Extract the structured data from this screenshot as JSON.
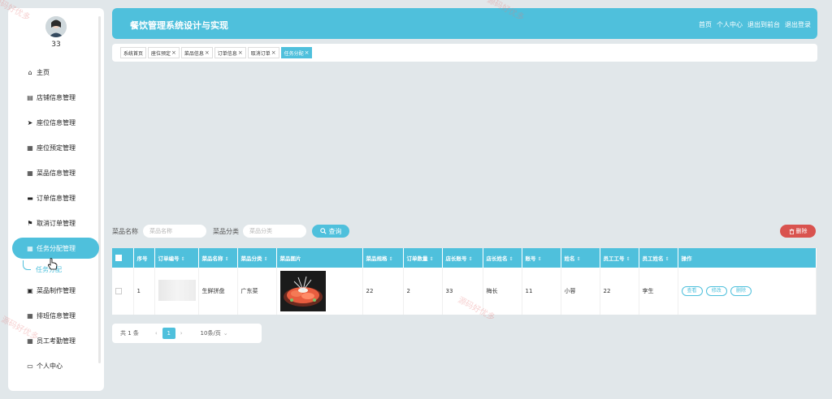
{
  "user": {
    "name": "33"
  },
  "menu": [
    {
      "label": "主页",
      "icon": "home-icon",
      "glyph": "⌂"
    },
    {
      "label": "店铺信息管理",
      "icon": "chart-icon",
      "glyph": "▤"
    },
    {
      "label": "座位信息管理",
      "icon": "send-icon",
      "glyph": "➤"
    },
    {
      "label": "座位预定管理",
      "icon": "grid-icon",
      "glyph": "▦"
    },
    {
      "label": "菜品信息管理",
      "icon": "apps-icon",
      "glyph": "▦"
    },
    {
      "label": "订单信息管理",
      "icon": "monitor-icon",
      "glyph": "▬"
    },
    {
      "label": "取消订单管理",
      "icon": "flag-icon",
      "glyph": "⚑"
    },
    {
      "label": "任务分配管理",
      "icon": "grid-icon",
      "glyph": "▦"
    },
    {
      "label": "菜品制作管理",
      "icon": "thumb-icon",
      "glyph": "▣"
    },
    {
      "label": "排班信息管理",
      "icon": "grid-icon",
      "glyph": "▦"
    },
    {
      "label": "员工考勤管理",
      "icon": "grid-icon",
      "glyph": "▦"
    },
    {
      "label": "个人中心",
      "icon": "card-icon",
      "glyph": "▭"
    }
  ],
  "submenu": {
    "label": "任务分配"
  },
  "header": {
    "title": "餐饮管理系统设计与实现",
    "nav": [
      "首页",
      "个人中心",
      "退出到前台",
      "退出登录"
    ]
  },
  "tabs": [
    {
      "label": "系统首页",
      "closable": false
    },
    {
      "label": "座位预定",
      "closable": true
    },
    {
      "label": "菜品信息",
      "closable": true
    },
    {
      "label": "订单信息",
      "closable": true
    },
    {
      "label": "取消订单",
      "closable": true
    },
    {
      "label": "任务分配",
      "closable": true,
      "active": true
    }
  ],
  "search": {
    "label1": "菜品名称",
    "placeholder1": "菜品名称",
    "label2": "菜品分类",
    "placeholder2": "菜品分类",
    "query_label": "查询",
    "delete_label": "删除"
  },
  "table": {
    "columns": [
      "序号",
      "订单编号",
      "菜品名称",
      "菜品分类",
      "菜品图片",
      "菜品规格",
      "订单数量",
      "店长账号",
      "店长姓名",
      "账号",
      "姓名",
      "员工工号",
      "员工姓名",
      "操作"
    ],
    "rows": [
      {
        "index": "1",
        "dish_name": "生鲜拼盘",
        "category": "广东菜",
        "spec": "22",
        "quantity": "2",
        "manager_account": "33",
        "manager_name": "梅长",
        "account": "11",
        "name": "小蓉",
        "staff_no": "22",
        "staff_name": "李生"
      }
    ],
    "actions": [
      "查看",
      "修改",
      "删除"
    ]
  },
  "pager": {
    "total": "共 1 条",
    "prev": "‹",
    "current": "1",
    "next": "›",
    "size": "10条/页"
  },
  "watermark": "源码好优多",
  "colors": {
    "primary": "#4fc0dc",
    "danger": "#d9534f",
    "background": "#e1e7ea"
  }
}
